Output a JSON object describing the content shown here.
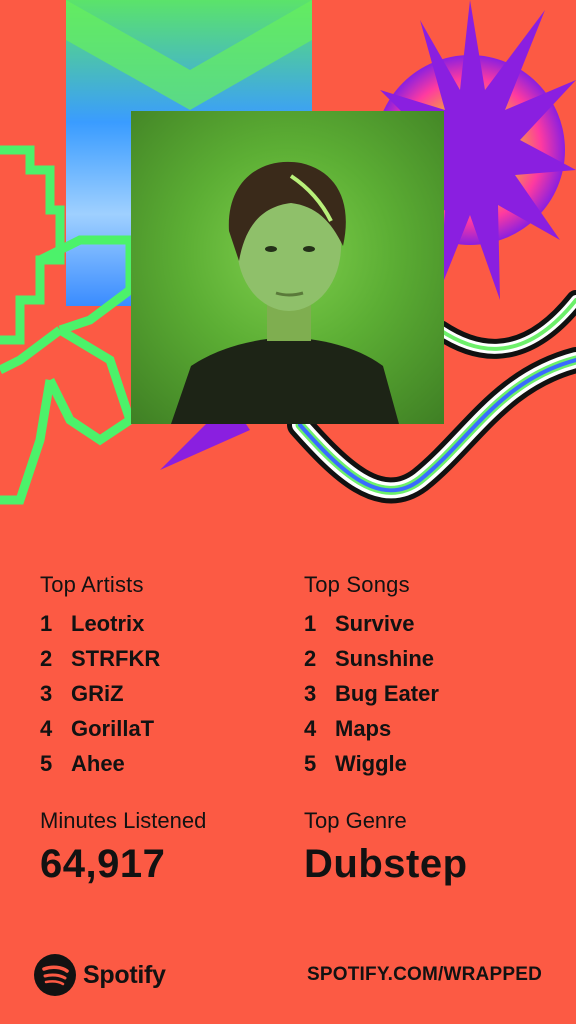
{
  "top_artists": {
    "heading": "Top Artists",
    "items": [
      {
        "rank": "1",
        "name": "Leotrix"
      },
      {
        "rank": "2",
        "name": "STRFKR"
      },
      {
        "rank": "3",
        "name": "GRiZ"
      },
      {
        "rank": "4",
        "name": "GorillaT"
      },
      {
        "rank": "5",
        "name": "Ahee"
      }
    ]
  },
  "top_songs": {
    "heading": "Top Songs",
    "items": [
      {
        "rank": "1",
        "name": "Survive"
      },
      {
        "rank": "2",
        "name": "Sunshine"
      },
      {
        "rank": "3",
        "name": "Bug Eater"
      },
      {
        "rank": "4",
        "name": "Maps"
      },
      {
        "rank": "5",
        "name": "Wiggle"
      }
    ]
  },
  "minutes": {
    "label": "Minutes Listened",
    "value": "64,917"
  },
  "genre": {
    "label": "Top Genre",
    "value": "Dubstep"
  },
  "footer": {
    "brand": "Spotify",
    "link": "SPOTIFY.COM/WRAPPED"
  },
  "colors": {
    "background": "#fc5a44",
    "text": "#121212",
    "accent_green": "#4cf26a",
    "accent_purple": "#8a1fe0"
  },
  "icons": {
    "logo": "spotify-logo-icon"
  }
}
